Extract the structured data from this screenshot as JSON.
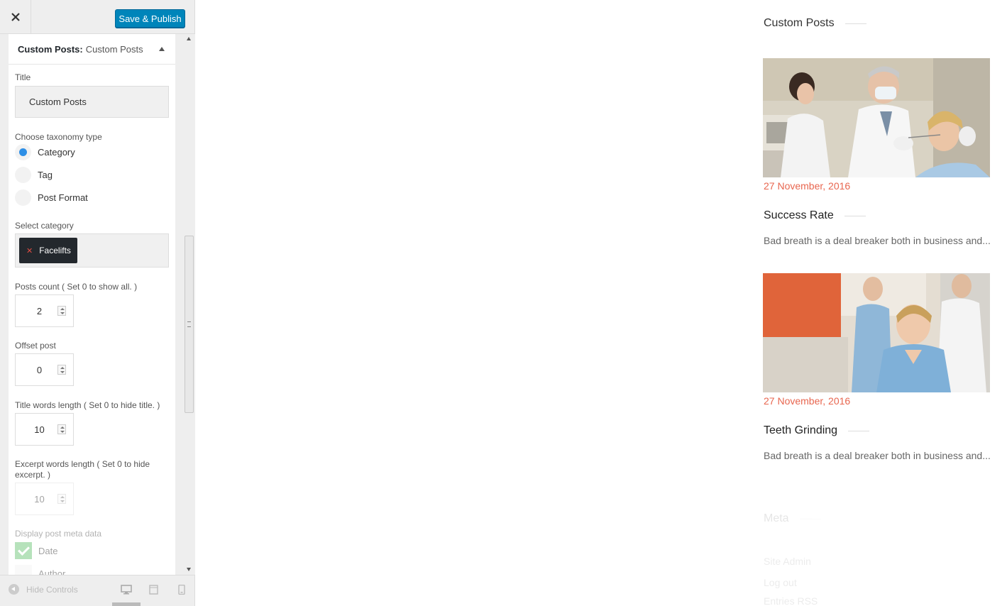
{
  "topbar": {
    "publish_label": "Save & Publish"
  },
  "panel": {
    "header_bold": "Custom Posts:",
    "header_rest": "Custom Posts",
    "title_label": "Title",
    "title_value": "Custom Posts",
    "taxonomy_label": "Choose taxonomy type",
    "taxonomy_options": [
      "Category",
      "Tag",
      "Post Format"
    ],
    "taxonomy_selected": "Category",
    "select_category_label": "Select category",
    "selected_category": "Facelifts",
    "posts_count_label": "Posts count ( Set 0 to show all. )",
    "posts_count_value": "2",
    "offset_label": "Offset post",
    "offset_value": "0",
    "title_words_label": "Title words length ( Set 0 to hide title. )",
    "title_words_value": "10",
    "excerpt_words_label": "Excerpt words length ( Set 0 to hide excerpt. )",
    "excerpt_words_value": "10",
    "meta_label": "Display post meta data",
    "meta_options": [
      {
        "label": "Date",
        "checked": true
      },
      {
        "label": "Author",
        "checked": false
      }
    ]
  },
  "footer": {
    "hide_controls_label": "Hide Controls"
  },
  "preview": {
    "widget_title": "Custom Posts",
    "posts": [
      {
        "date": "27 November, 2016",
        "title": "Success Rate",
        "excerpt": "Bad breath is a deal breaker both in business and..."
      },
      {
        "date": "27 November, 2016",
        "title": "Teeth Grinding",
        "excerpt": "Bad breath is a deal breaker both in business and..."
      }
    ],
    "meta_widget": {
      "title": "Meta",
      "links": [
        "Site Admin",
        "Log out",
        "Entries RSS"
      ]
    }
  },
  "colors": {
    "accent_blue": "#0085ba",
    "date_color": "#e8664f",
    "radio_selected": "#2e8fe6",
    "checkbox_checked": "#5fbf6a"
  }
}
